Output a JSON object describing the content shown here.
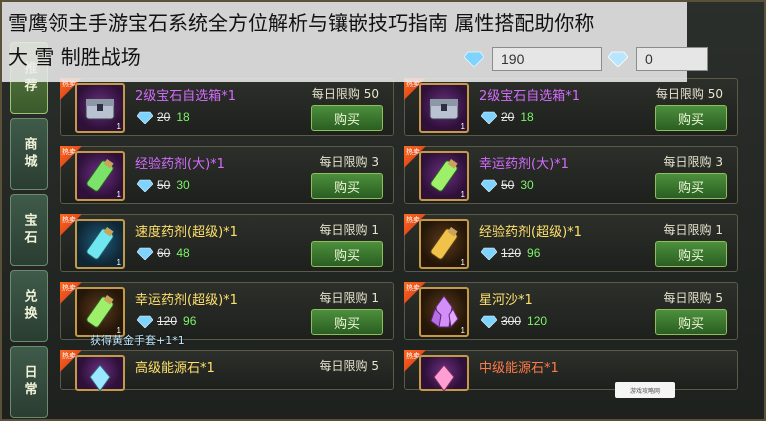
{
  "title_overlay": {
    "line1": "雪鹰领主手游宝石系统全方位解析与镶嵌技巧指南 属性搭配助你称",
    "line2": "大 雪 制胜战场"
  },
  "currency": {
    "diamond_value": "190",
    "bound_diamond_value": "0"
  },
  "sidebar": {
    "tabs": [
      {
        "label": "推荐",
        "active": true
      },
      {
        "label": "商城",
        "active": false
      },
      {
        "label": "宝石",
        "active": false
      },
      {
        "label": "兑换",
        "active": false
      },
      {
        "label": "日常",
        "active": false
      }
    ]
  },
  "items": [
    {
      "name": "2级宝石自选箱*1",
      "limit": "每日限购 50",
      "old_price": "20",
      "new_price": "18",
      "buy": "购买",
      "icon": "chest-icon",
      "name_color": "purple"
    },
    {
      "name": "2级宝石自选箱*1",
      "limit": "每日限购 50",
      "old_price": "20",
      "new_price": "18",
      "buy": "购买",
      "icon": "chest-icon",
      "name_color": "purple"
    },
    {
      "name": "经验药剂(大)*1",
      "limit": "每日限购 3",
      "old_price": "50",
      "new_price": "30",
      "buy": "购买",
      "icon": "exp-potion-icon",
      "name_color": "purple"
    },
    {
      "name": "幸运药剂(大)*1",
      "limit": "每日限购 3",
      "old_price": "50",
      "new_price": "30",
      "buy": "购买",
      "icon": "luck-potion-icon",
      "name_color": "purple"
    },
    {
      "name": "速度药剂(超级)*1",
      "limit": "每日限购 1",
      "old_price": "60",
      "new_price": "48",
      "buy": "购买",
      "icon": "speed-potion-icon",
      "name_color": "yellow"
    },
    {
      "name": "经验药剂(超级)*1",
      "limit": "每日限购 1",
      "old_price": "120",
      "new_price": "96",
      "buy": "购买",
      "icon": "exp-potion-icon",
      "name_color": "yellow"
    },
    {
      "name": "幸运药剂(超级)*1",
      "limit": "每日限购 1",
      "old_price": "120",
      "new_price": "96",
      "buy": "购买",
      "icon": "luck-potion-icon",
      "name_color": "yellow"
    },
    {
      "name": "星河沙*1",
      "limit": "每日限购 5",
      "old_price": "300",
      "new_price": "120",
      "buy": "购买",
      "icon": "crystal-icon",
      "name_color": "yellow"
    },
    {
      "name": "高级能源石*1",
      "limit": "每日限购 5",
      "old_price": "",
      "new_price": "",
      "buy": "",
      "icon": "energy-stone-icon",
      "name_color": "yellow"
    },
    {
      "name": "中级能源石*1",
      "limit": "",
      "old_price": "",
      "new_price": "",
      "buy": "",
      "icon": "energy-stone-icon",
      "name_color": "yellow"
    }
  ],
  "tooltip": "获得黄金手套+1*1",
  "watermark": "游戏攻略网",
  "hot_badge": "热卖",
  "colors": {
    "purple_name": "#d66bff",
    "yellow_name": "#ffe06b",
    "new_price": "#7ef26a",
    "buy_button": "#3b7a2f"
  }
}
